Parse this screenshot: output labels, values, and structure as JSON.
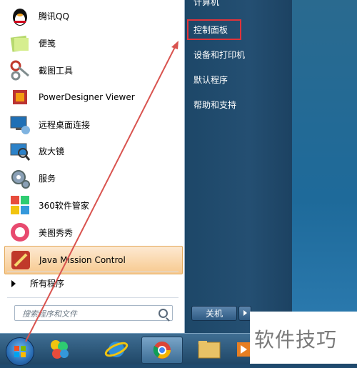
{
  "programs": [
    {
      "label": "腾讯QQ",
      "icon": "qq-penguin-icon"
    },
    {
      "label": "便笺",
      "icon": "sticky-notes-icon"
    },
    {
      "label": "截图工具",
      "icon": "snipping-tool-icon"
    },
    {
      "label": "PowerDesigner Viewer",
      "icon": "powerdesigner-icon"
    },
    {
      "label": "远程桌面连接",
      "icon": "remote-desktop-icon"
    },
    {
      "label": "放大镜",
      "icon": "magnifier-icon"
    },
    {
      "label": "服务",
      "icon": "services-gear-icon"
    },
    {
      "label": "360软件管家",
      "icon": "software-manager-360-icon"
    },
    {
      "label": "美图秀秀",
      "icon": "meitu-xiuxiu-icon"
    },
    {
      "label": "Java Mission Control",
      "icon": "java-mission-control-icon"
    }
  ],
  "all_programs": "所有程序",
  "search": {
    "placeholder": "搜索程序和文件"
  },
  "right_menu": {
    "computer": "计算机",
    "control_panel": "控制面板",
    "devices_printers": "设备和打印机",
    "default_programs": "默认程序",
    "help_support": "帮助和支持"
  },
  "shutdown_label": "关机",
  "watermark": "软件技巧",
  "colors": {
    "highlight_box": "#e1333a",
    "annotation_arrow": "#d9534f",
    "right_pane": "#1d4768"
  }
}
